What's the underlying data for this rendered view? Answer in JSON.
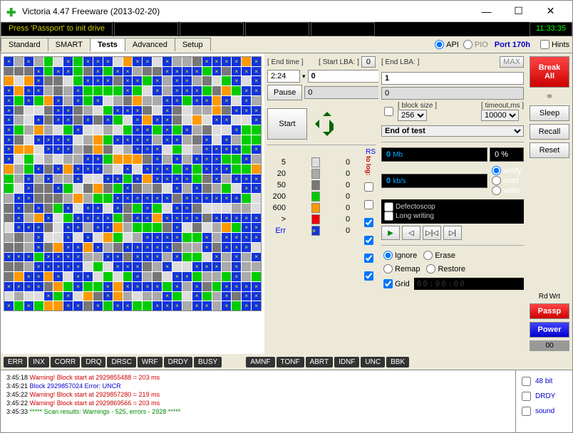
{
  "title": "Victoria 4.47  Freeware (2013-02-20)",
  "status_msg": "Press 'Passport' to init drive",
  "clock": "11:33:35",
  "tabs": [
    "Standard",
    "SMART",
    "Tests",
    "Advanced",
    "Setup"
  ],
  "active_tab": "Tests",
  "api_label": "API",
  "pio_label": "PIO",
  "port": "Port 170h",
  "hints": "Hints",
  "mid": {
    "end_time_label": "[ End time ]",
    "end_time": "2:24",
    "pause": "Pause",
    "start": "Start",
    "start_lba_label": "[ Start LBA: ]",
    "start_lba_btn": "0",
    "start_lba": "0",
    "end_lba_label": "[ End LBA: ]",
    "end_lba_btn": "MAX",
    "end_lba": "1",
    "val_a": "0",
    "val_b": "0",
    "block_size_label": "[ block size ]",
    "block_size": "256",
    "timeout_label": "[ timeout,ms ]",
    "timeout": "10000",
    "action": "End of test",
    "rs": "RS",
    "tolog": "to log:",
    "legend": [
      {
        "t": "5",
        "c": "#ddd",
        "n": "0"
      },
      {
        "t": "20",
        "c": "#aaa",
        "n": "0"
      },
      {
        "t": "50",
        "c": "#777",
        "n": "0"
      },
      {
        "t": "200",
        "c": "#0c0",
        "n": "0"
      },
      {
        "t": "600",
        "c": "#f90",
        "n": "0"
      },
      {
        "t": ">",
        "c": "#e00",
        "n": "0"
      },
      {
        "t": "Err",
        "c": "#13d",
        "n": "0",
        "err": true
      }
    ]
  },
  "right": {
    "mb": "0",
    "mb_unit": "Mb",
    "pct": "0",
    "pct_unit": "%",
    "kbs": "0",
    "kbs_unit": "kb/s",
    "verify": "verify",
    "read": "read",
    "write": "write",
    "defectoscop": "Defectoscop",
    "long_writing": "Long writing",
    "ignore": "Ignore",
    "remap": "Remap",
    "erase": "Erase",
    "restore": "Restore",
    "grid": "Grid",
    "timer": "00:00:00"
  },
  "far": {
    "break": "Break\nAll",
    "sleep": "Sleep",
    "recall": "Recall",
    "reset": "Reset",
    "rd": "Rd",
    "wrt": "Wrt",
    "passp": "Passp",
    "power": "Power",
    "c00": "00"
  },
  "flags1": [
    "ERR",
    "INX",
    "CORR",
    "DRQ",
    "DRSC",
    "WRF",
    "DRDY",
    "BUSY"
  ],
  "flags2": [
    "AMNF",
    "TONF",
    "ABRT",
    "IDNF",
    "UNC",
    "BBK"
  ],
  "log": [
    {
      "t": "3:45:18",
      "m": "Warning! Block start at 2929855488 = 203 ms",
      "c": "warn"
    },
    {
      "t": "3:45:21",
      "m": "Block 2929857024 Error: UNCR",
      "c": "err"
    },
    {
      "t": "3:45:22",
      "m": "Warning! Block start at 2929857280 = 219 ms",
      "c": "warn"
    },
    {
      "t": "3:45:22",
      "m": "Warning! Block start at 2929869566 = 203 ms",
      "c": "warn"
    },
    {
      "t": "3:45:33",
      "m": "***** Scan results: Warnings - 525, errors - 2928 *****",
      "c": "sum"
    }
  ],
  "logside": [
    "48 bit",
    "DRDY",
    "sound"
  ]
}
